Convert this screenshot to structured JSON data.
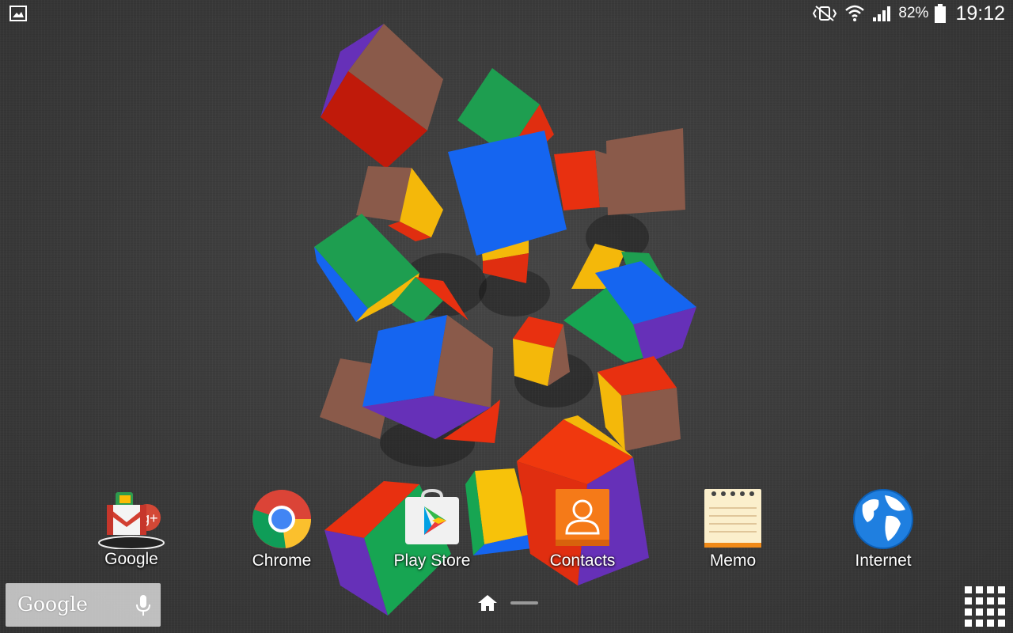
{
  "status_bar": {
    "battery_percent": "82%",
    "time": "19:12",
    "icons": [
      "gallery-notification-icon",
      "vibrate-icon",
      "wifi-icon",
      "signal-icon",
      "battery-icon"
    ]
  },
  "dock": [
    {
      "label": "Google",
      "icon": "google-folder-icon"
    },
    {
      "label": "Chrome",
      "icon": "chrome-icon"
    },
    {
      "label": "Play Store",
      "icon": "play-store-icon"
    },
    {
      "label": "Contacts",
      "icon": "contacts-icon"
    },
    {
      "label": "Memo",
      "icon": "memo-icon"
    },
    {
      "label": "Internet",
      "icon": "globe-icon"
    }
  ],
  "search_bar": {
    "logo_text": "Google",
    "icon": "mic-icon"
  },
  "navigation": {
    "home_icon": "home-icon",
    "apps_icon": "apps-grid-icon"
  },
  "colors": {
    "cube_red": "#e8310c",
    "cube_blue": "#1565f0",
    "cube_green": "#17a552",
    "cube_yellow": "#f7c20a",
    "cube_brown": "#8a5a4a",
    "cube_purple": "#6630b8",
    "orange_contacts": "#f57a18"
  }
}
